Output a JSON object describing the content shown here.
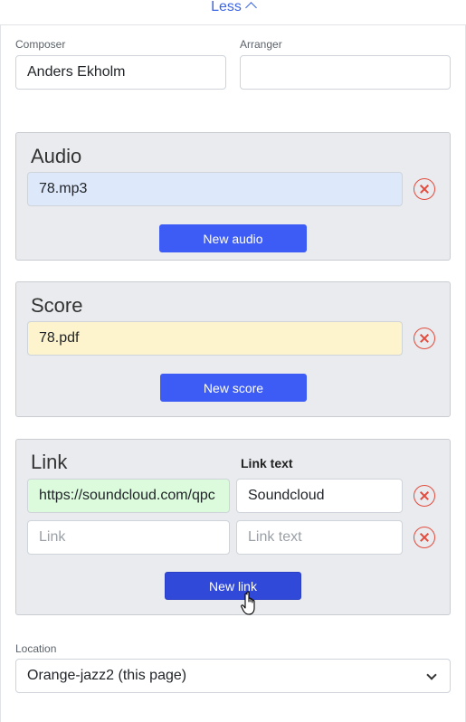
{
  "toggle": {
    "label": "Less"
  },
  "composer": {
    "label": "Composer",
    "value": "Anders Ekholm"
  },
  "arranger": {
    "label": "Arranger",
    "value": ""
  },
  "audio": {
    "title": "Audio",
    "files": [
      "78.mp3"
    ],
    "new_button": "New audio",
    "file_color": "#dde9fb"
  },
  "score": {
    "title": "Score",
    "files": [
      "78.pdf"
    ],
    "new_button": "New score",
    "file_color": "#fdf3cc"
  },
  "links": {
    "title": "Link",
    "text_header": "Link text",
    "rows": [
      {
        "url": "https://soundcloud.com/qpc",
        "text": "Soundcloud"
      },
      {
        "url_placeholder": "Link",
        "text_placeholder": "Link text"
      }
    ],
    "new_button": "New link",
    "url_color": "#dcfbdc"
  },
  "location": {
    "label": "Location",
    "value": "Orange-jazz2 (this page)"
  },
  "colors": {
    "accent": "#3d5cf5",
    "remove": "#e34b3d"
  }
}
